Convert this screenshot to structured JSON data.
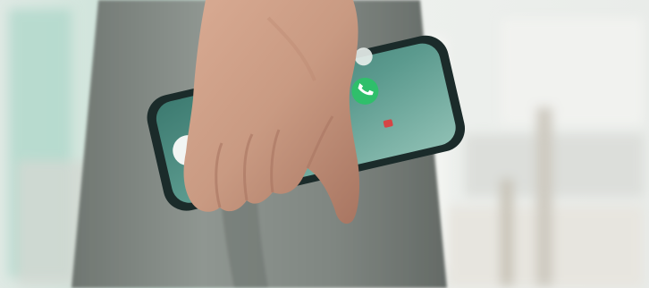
{
  "scene": {
    "description_colors": {
      "background_light": "#e9eeeb",
      "background_mint": "#bfe0d3",
      "trousers": "#8d948f",
      "trousers_shadow": "#6f7671",
      "skin": "#c99a82",
      "skin_shadow": "#a87561",
      "phone_frame": "#1b2b2a",
      "phone_screen": "#2f6f65",
      "call_green": "#2fbf6b",
      "call_red": "#d64545"
    }
  },
  "phone": {
    "status_bar": "",
    "caller_name": "",
    "call_status": ""
  }
}
